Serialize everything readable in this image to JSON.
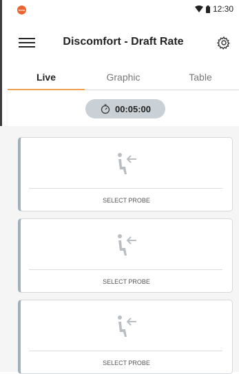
{
  "status_bar": {
    "time": "12:30"
  },
  "app_bar": {
    "title": "Discomfort - Draft Rate"
  },
  "tabs": [
    {
      "label": "Live",
      "active": true
    },
    {
      "label": "Graphic",
      "active": false
    },
    {
      "label": "Table",
      "active": false
    }
  ],
  "timer": {
    "value": "00:05:00"
  },
  "probe_cards": [
    {
      "label": "SELECT PROBE"
    },
    {
      "label": "SELECT PROBE"
    },
    {
      "label": "SELECT PROBE"
    }
  ],
  "colors": {
    "accent": "#f0a24f",
    "card_border": "#9eb0bc",
    "timer_bg": "#c9d1d6",
    "icon": "#b8bec2"
  }
}
